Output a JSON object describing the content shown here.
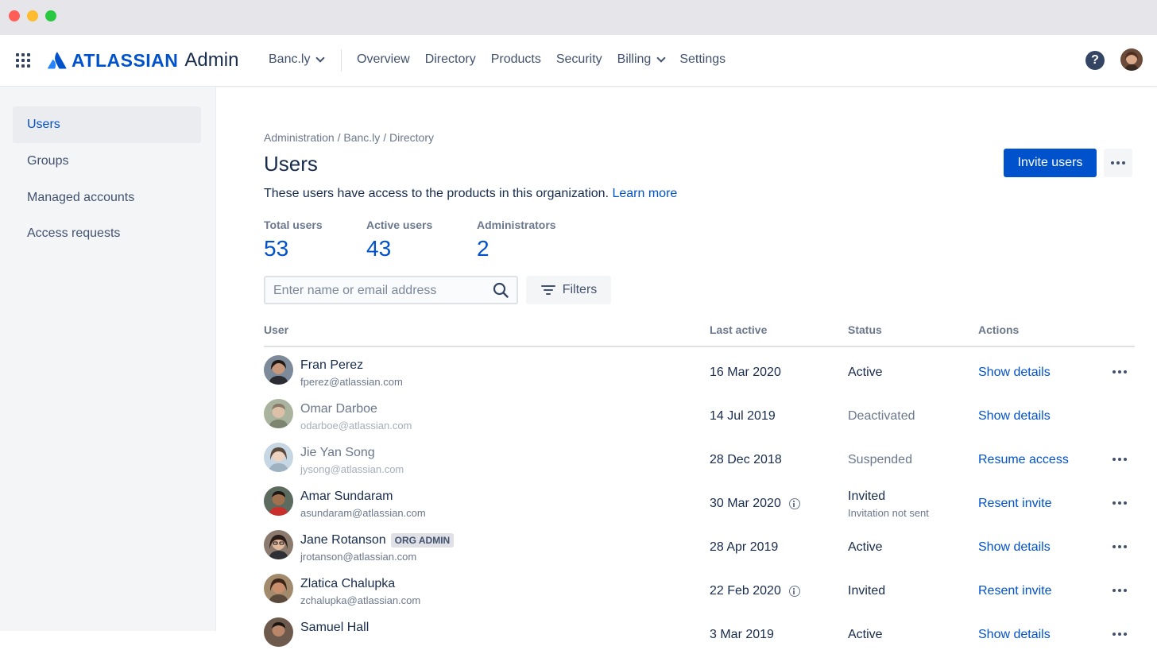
{
  "brand": {
    "wordmark": "ATLASSIAN",
    "product": "Admin",
    "color": "#0052CC"
  },
  "topnav": {
    "org": "Banc.ly",
    "items": [
      {
        "label": "Overview"
      },
      {
        "label": "Directory"
      },
      {
        "label": "Products"
      },
      {
        "label": "Security"
      },
      {
        "label": "Billing",
        "has_dropdown": true
      },
      {
        "label": "Settings"
      }
    ],
    "help_glyph": "?"
  },
  "sidebar": {
    "items": [
      {
        "label": "Users",
        "active": true
      },
      {
        "label": "Groups"
      },
      {
        "label": "Managed accounts"
      },
      {
        "label": "Access requests"
      }
    ]
  },
  "breadcrumb": [
    "Administration",
    "Banc.ly",
    "Directory"
  ],
  "breadcrumb_sep": "/",
  "page": {
    "title": "Users",
    "description": "These users have access to the products in this organization.",
    "learn_more": "Learn more",
    "invite_label": "Invite users"
  },
  "stats": [
    {
      "label": "Total users",
      "value": "53"
    },
    {
      "label": "Active users",
      "value": "43"
    },
    {
      "label": "Administrators",
      "value": "2"
    }
  ],
  "search": {
    "placeholder": "Enter name or email address",
    "value": ""
  },
  "filters_label": "Filters",
  "table": {
    "columns": [
      "User",
      "Last active",
      "Status",
      "Actions"
    ],
    "rows": [
      {
        "name": "Fran Perez",
        "email": "fperez@atlassian.com",
        "last_active": "16 Mar 2020",
        "status": "Active",
        "status_sub": "",
        "action": "Show details",
        "badge": "",
        "info": false,
        "more": true,
        "dim": false
      },
      {
        "name": "Omar Darboe",
        "email": "odarboe@atlassian.com",
        "last_active": "14 Jul 2019",
        "status": "Deactivated",
        "status_sub": "",
        "action": "Show details",
        "badge": "",
        "info": false,
        "more": false,
        "dim": true
      },
      {
        "name": "Jie Yan Song",
        "email": "jysong@atlassian.com",
        "last_active": "28 Dec 2018",
        "status": "Suspended",
        "status_sub": "",
        "action": "Resume access",
        "badge": "",
        "info": false,
        "more": true,
        "dim": true
      },
      {
        "name": "Amar Sundaram",
        "email": "asundaram@atlassian.com",
        "last_active": "30 Mar 2020",
        "status": "Invited",
        "status_sub": "Invitation not sent",
        "action": "Resent invite",
        "badge": "",
        "info": true,
        "more": true,
        "dim": false
      },
      {
        "name": "Jane Rotanson",
        "email": "jrotanson@atlassian.com",
        "last_active": "28 Apr 2019",
        "status": "Active",
        "status_sub": "",
        "action": "Show details",
        "badge": "ORG ADMIN",
        "info": false,
        "more": true,
        "dim": false
      },
      {
        "name": "Zlatica Chalupka",
        "email": "zchalupka@atlassian.com",
        "last_active": "22 Feb 2020",
        "status": "Invited",
        "status_sub": "",
        "action": "Resent invite",
        "badge": "",
        "info": true,
        "more": true,
        "dim": false
      },
      {
        "name": "Samuel Hall",
        "email": "",
        "last_active": "3 Mar 2019",
        "status": "Active",
        "status_sub": "",
        "action": "Show details",
        "badge": "",
        "info": false,
        "more": true,
        "dim": false
      }
    ]
  },
  "icons": {
    "app_switcher": "grid-icon",
    "search": "search-icon",
    "filters": "filter-icon",
    "more": "more-icon",
    "help": "help-icon",
    "info": "info-icon",
    "chevron": "chevron-down-icon"
  }
}
